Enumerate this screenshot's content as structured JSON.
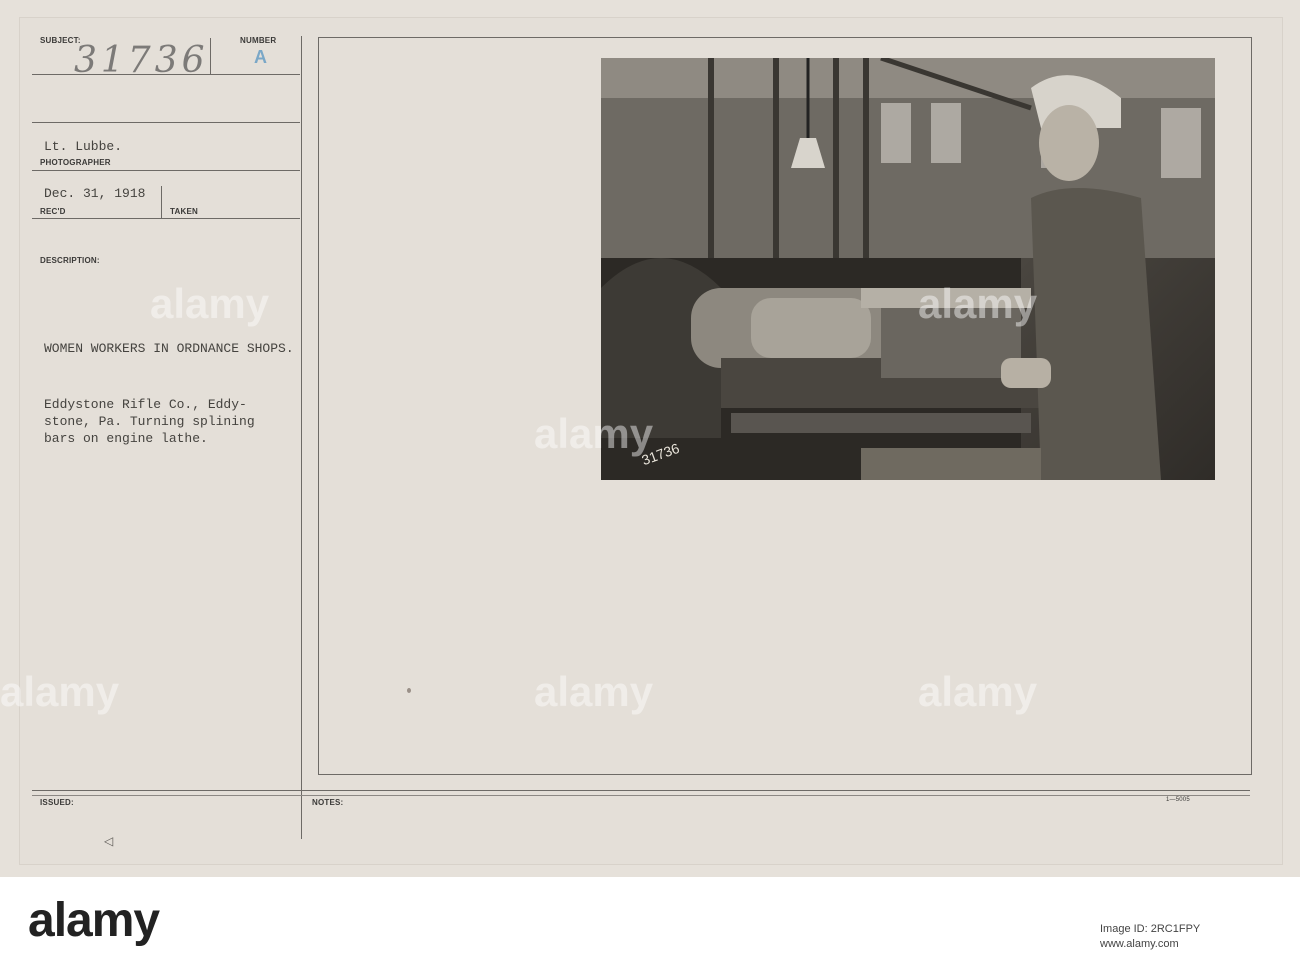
{
  "card": {
    "subject_label": "SUBJECT:",
    "subject_value": "31736",
    "number_label": "NUMBER",
    "number_value": "A",
    "photographer_value": "Lt. Lubbe.",
    "photographer_label": "PHOTOGRAPHER",
    "date_value": "Dec. 31, 1918",
    "recd_label": "REC'D",
    "taken_label": "TAKEN",
    "description_label": "DESCRIPTION:",
    "description_title": "WOMEN WORKERS IN ORDNANCE SHOPS.",
    "description_body": "Eddystone Rifle Co., Eddy-\nstone, Pa. Turning splining\nbars on engine lathe.",
    "issued_label": "ISSUED:",
    "notes_label": "NOTES:",
    "form_code": "1—5005",
    "photo_negative_number": "31736"
  },
  "watermarks": {
    "text": "alamy"
  },
  "footer": {
    "logo": "alamy",
    "image_id": "Image ID: 2RC1FPY",
    "url": "www.alamy.com"
  },
  "colors": {
    "card_bg": "#e4dfd8",
    "ink": "#45433f",
    "photo_dark": "#2f2c28"
  }
}
